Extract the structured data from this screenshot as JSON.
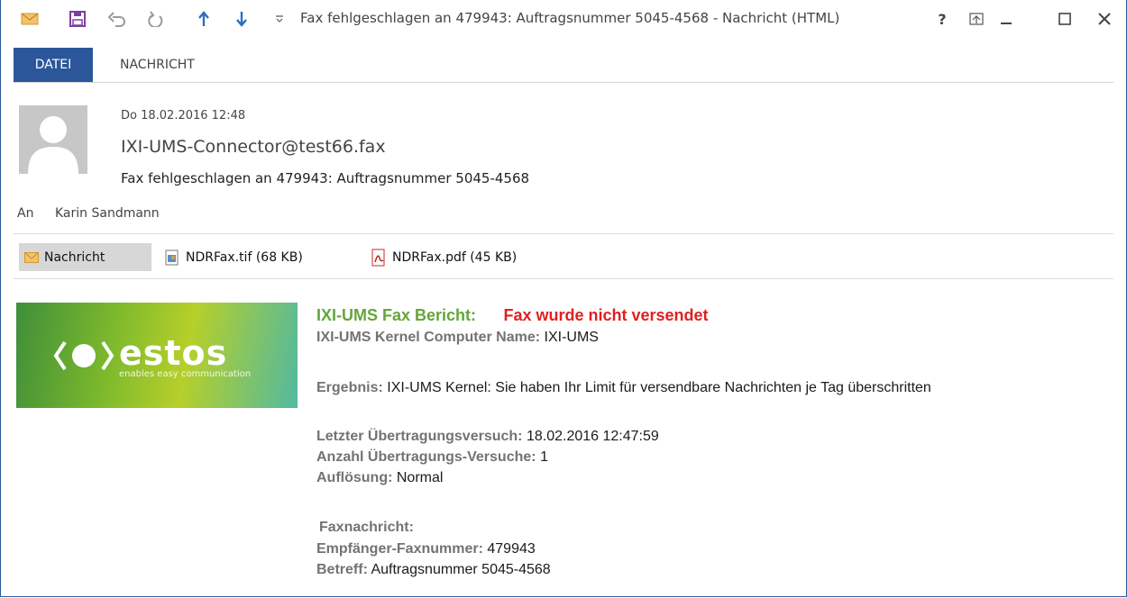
{
  "window": {
    "title": "Fax fehlgeschlagen an 479943: Auftragsnummer 5045-4568 - Nachricht (HTML)",
    "help_label": "?",
    "colors": {
      "accent": "#2b579a",
      "report_title": "#64a63a",
      "report_status": "#e02020"
    }
  },
  "quick_access": {
    "icons": [
      "envelope-icon",
      "save-icon",
      "undo-icon",
      "redo-icon",
      "up-arrow-icon",
      "down-arrow-icon",
      "customize-icon"
    ]
  },
  "ribbon": {
    "tabs": [
      {
        "label": "DATEI",
        "active": true
      },
      {
        "label": "NACHRICHT",
        "active": false
      }
    ]
  },
  "message": {
    "date": "Do 18.02.2016 12:48",
    "sender": "IXI-UMS-Connector@test66.fax",
    "subject": "Fax fehlgeschlagen an 479943: Auftragsnummer 5045-4568",
    "to_label": "An",
    "to_value": "Karin Sandmann"
  },
  "attachments": [
    {
      "label": "Nachricht",
      "icon": "envelope-icon",
      "selected": true
    },
    {
      "label": "NDRFax.tif (68 KB)",
      "icon": "image-file-icon",
      "selected": false
    },
    {
      "label": "NDRFax.pdf (45 KB)",
      "icon": "pdf-file-icon",
      "selected": false
    }
  ],
  "banner": {
    "brand": "estos",
    "tagline": "enables easy communication"
  },
  "report": {
    "title": "IXI-UMS Fax Bericht:",
    "status": "Fax wurde nicht versendet",
    "computer_label": "IXI-UMS Kernel Computer Name:",
    "computer_value": "IXI-UMS",
    "result_label": "Ergebnis:",
    "result_value": "IXI-UMS Kernel: Sie haben Ihr Limit für versendbare Nachrichten je Tag überschritten",
    "last_attempt_label": "Letzter Übertragungsversuch:",
    "last_attempt_value": "18.02.2016 12:47:59",
    "attempts_label": "Anzahl Übertragungs-Versuche:",
    "attempts_value": "1",
    "resolution_label": "Auflösung:",
    "resolution_value": "Normal",
    "fax_heading": "Faxnachricht:",
    "recipient_label": "Empfänger-Faxnummer:",
    "recipient_value": "479943",
    "subject_label": "Betreff:",
    "subject_value": "Auftragsnummer 5045-4568"
  }
}
